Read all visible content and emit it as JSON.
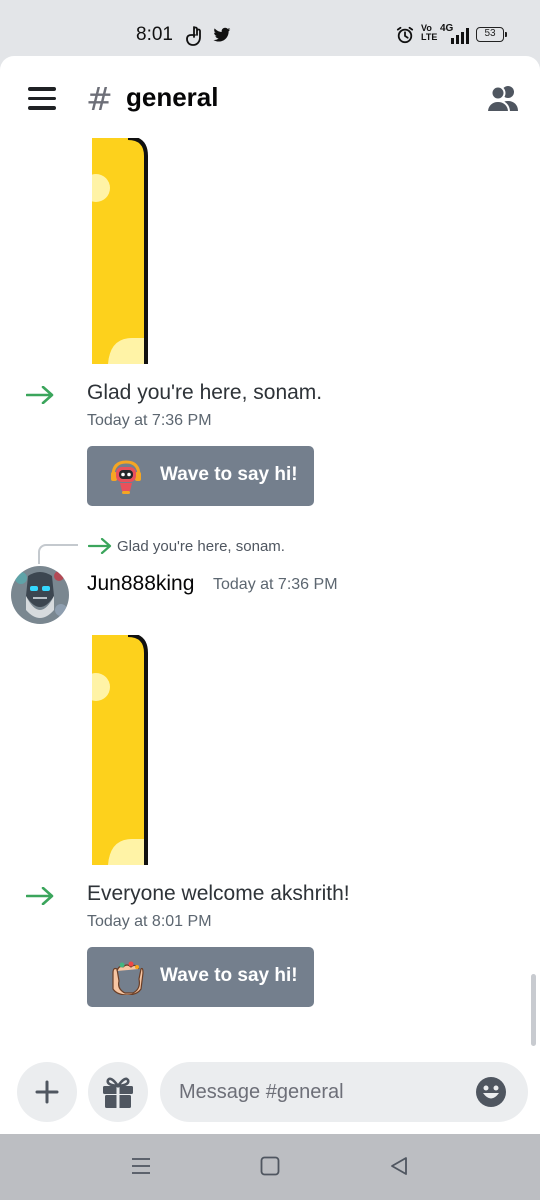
{
  "status_bar": {
    "time": "8:01",
    "network": "4G",
    "volte": "Vo LTE",
    "battery": "53"
  },
  "header": {
    "channel_name": "general",
    "menu_icon": "hamburger-icon",
    "members_icon": "members-icon"
  },
  "messages": [
    {
      "type": "welcome",
      "text": "Glad you're here, sonam.",
      "timestamp": "Today at 7:36 PM",
      "wave_label": "Wave to say hi!",
      "wave_art": "robot-sticker"
    },
    {
      "type": "reply",
      "reply_to": "Glad you're here, sonam.",
      "author": "Jun888king",
      "timestamp": "Today at 7:36 PM",
      "sticker": "yellow-sticker"
    },
    {
      "type": "welcome",
      "text": "Everyone welcome akshrith!",
      "timestamp": "Today at 8:01 PM",
      "wave_label": "Wave to say hi!",
      "wave_art": "hands-sticker"
    }
  ],
  "composer": {
    "placeholder": "Message #general"
  },
  "colors": {
    "accent_green": "#3ba55c",
    "wave_button": "#747f8d",
    "sticker_yellow": "#fdd11c"
  }
}
